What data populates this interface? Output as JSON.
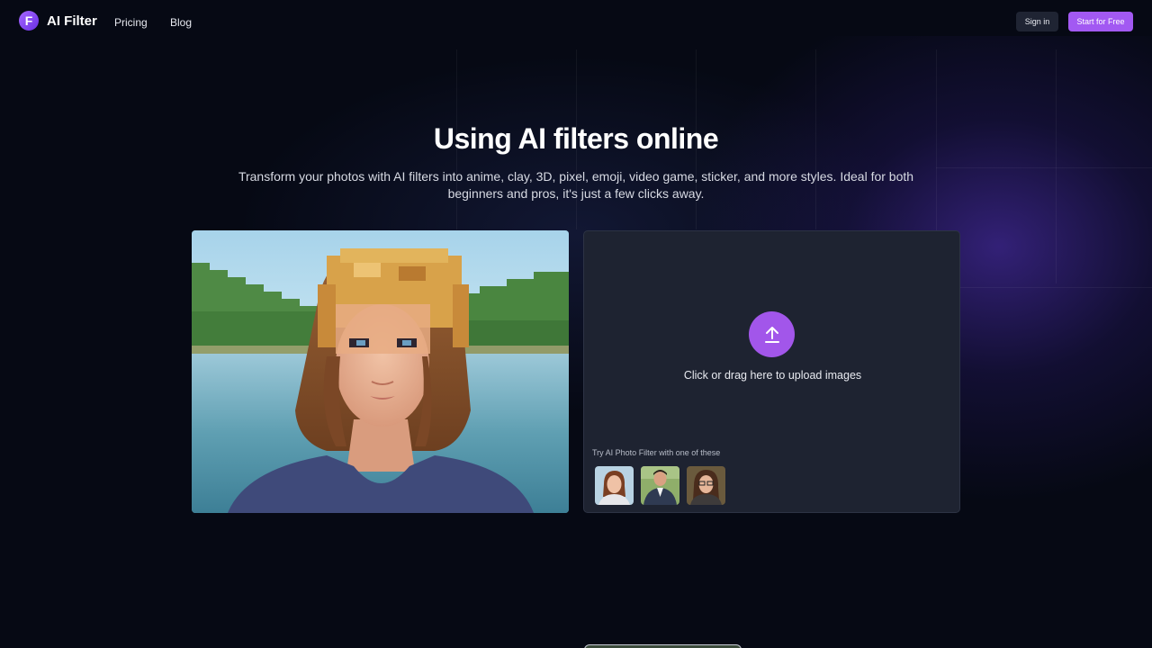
{
  "brand": {
    "logo_letter": "F",
    "name": "AI Filter",
    "accent_color": "#a259f2"
  },
  "nav": {
    "links": [
      "Pricing",
      "Blog"
    ],
    "sign_in": "Sign in",
    "start_free": "Start for Free"
  },
  "hero": {
    "title": "Using AI filters online",
    "subtitle": "Transform your photos with AI filters into anime, clay, 3D, pixel, emoji, video game, sticker, and more styles. Ideal for both beginners and pros, it's just a few clicks away."
  },
  "upload": {
    "icon": "upload-arrow-icon",
    "label": "Click or drag here to upload images",
    "samples_label": "Try AI Photo Filter with one of these",
    "samples": [
      "sample-woman-portrait",
      "sample-man-suit",
      "sample-woman-glasses"
    ]
  }
}
